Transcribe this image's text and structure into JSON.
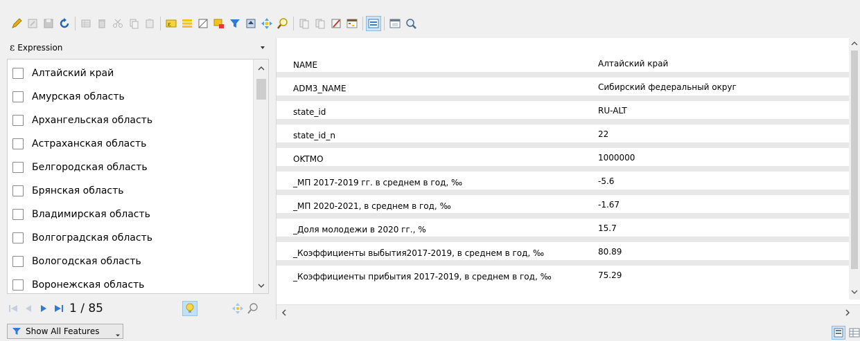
{
  "toolbar": {
    "icons": [
      "pencil-icon",
      "multi-edit-icon",
      "save-icon",
      "reload-icon",
      "add-feature-icon",
      "delete-icon",
      "cut-icon",
      "copy-icon",
      "paste-icon",
      "expression-select-icon",
      "select-all-icon",
      "invert-selection-icon",
      "deselect-icon",
      "filter-icon",
      "move-top-icon",
      "pan-map-icon",
      "zoom-map-icon",
      "copy-cells-icon",
      "paste-cells-icon",
      "field-calculator-icon",
      "conditional-format-icon",
      "new-field-icon",
      "actions-icon",
      "dock-icon"
    ]
  },
  "left_panel": {
    "expression_label": "Expression",
    "items": [
      "Алтайский край",
      "Амурская область",
      "Архангельская область",
      "Астраханская область",
      "Белгородская область",
      "Брянская область",
      "Владимирская область",
      "Волгоградская область",
      "Вологодская область",
      "Воронежская область"
    ],
    "page": "1 / 85"
  },
  "attributes": [
    {
      "name": "NAME",
      "value": "Алтайский край"
    },
    {
      "name": "ADM3_NAME",
      "value": "Сибирский федеральный округ"
    },
    {
      "name": "state_id",
      "value": "RU-ALT"
    },
    {
      "name": "state_id_n",
      "value": "22"
    },
    {
      "name": "OKTMO",
      "value": "1000000"
    },
    {
      "name": "_МП 2017-2019 гг. в среднем в год, ‰",
      "value": "-5.6"
    },
    {
      "name": "_МП 2020-2021, в среднем в год, ‰",
      "value": "-1.67"
    },
    {
      "name": "_Доля молодежи в 2020 гг., %",
      "value": "15.7"
    },
    {
      "name": "_Коэффициенты выбытия2017-2019, в среднем в год, ‰",
      "value": "80.89"
    },
    {
      "name": "_Коэффициенты прибытия 2017-2019, в среднем в год, ‰",
      "value": "75.29"
    }
  ],
  "status": {
    "show_button_label": "Show All Features"
  },
  "colors": {
    "accent": "#2e7bd6",
    "selection": "#cfe4f7"
  }
}
